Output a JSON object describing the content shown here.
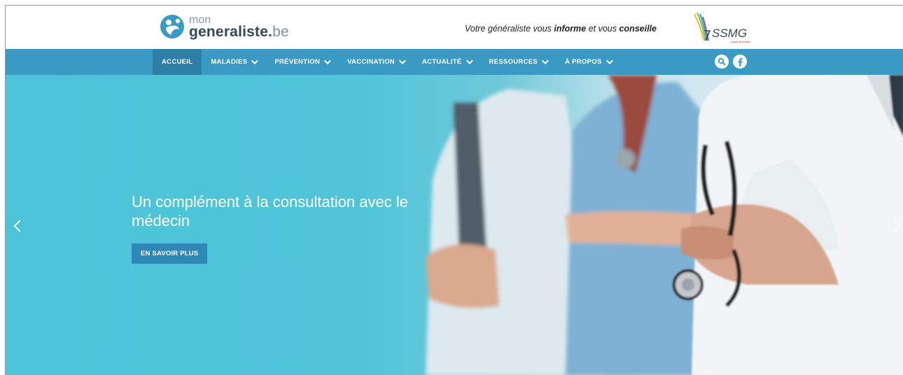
{
  "header": {
    "logo": {
      "prefix": "mon",
      "name": "generaliste.",
      "suffix": "be"
    },
    "tagline": {
      "part1": "Votre généraliste vous ",
      "bold1": "informe",
      "part2": " et vous ",
      "bold2": "conseille"
    },
    "partner_logo": {
      "text": "SSMG",
      "subtext": "Santé Bruxelles"
    }
  },
  "nav": {
    "items": [
      {
        "label": "ACCUEIL",
        "active": true,
        "dropdown": false
      },
      {
        "label": "MALADIES",
        "active": false,
        "dropdown": true
      },
      {
        "label": "PRÉVENTION",
        "active": false,
        "dropdown": true
      },
      {
        "label": "VACCINATION",
        "active": false,
        "dropdown": true
      },
      {
        "label": "ACTUALITÉ",
        "active": false,
        "dropdown": true
      },
      {
        "label": "RESSOURCES",
        "active": false,
        "dropdown": true
      },
      {
        "label": "À PROPOS",
        "active": false,
        "dropdown": true
      }
    ],
    "icons": [
      "search-icon",
      "facebook-icon"
    ]
  },
  "hero": {
    "title": "Un complément à la consultation avec le médecin",
    "button": "EN SAVOIR PLUS"
  },
  "colors": {
    "nav_bg": "#3a9ac3",
    "nav_active": "#2d7fa6",
    "hero_bg": "#4cc3d8",
    "button_bg": "#2d88b5"
  }
}
